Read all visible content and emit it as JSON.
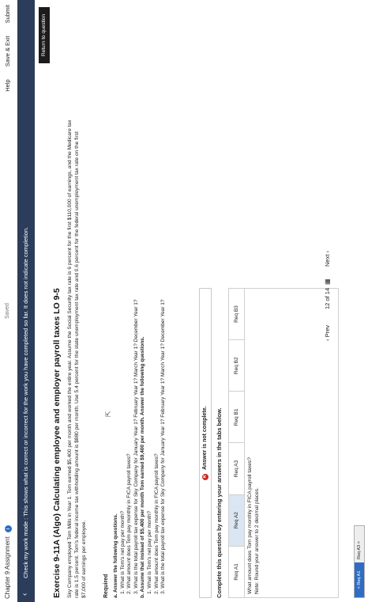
{
  "topbar": {
    "chapter": "Chapter 9 Assignment",
    "saved": "Saved",
    "help": "Help",
    "save_exit": "Save & Exit",
    "submit": "Submit"
  },
  "mode_bar": {
    "text": "Check my work mode : This shows what is correct or incorrect for the work you have completed so far. It does not indicate completion."
  },
  "return_button": "Return to question",
  "exercise": {
    "title": "Exercise 9-11A (Algo) Calculating employee and employer payroll taxes LO 9-5",
    "paragraph": "Sky Company employed Tom Mills in Year 1. Tom earned $5,400 per month and worked the entire year. Assume the Social Security tax rate is 6 percent for the first $110,000 of earnings, and the Medicare tax rate is 1.5 percent. Tom's federal income tax withholding amount is $880 per month. Use 5.4 percent for the state unemployment tax rate and 0.6 percent for the federal unemployment tax rate on the first $7,000 of earnings per employee.",
    "required_label": "Required",
    "a_label": "a. Answer the following questions.",
    "a1": "1. What is Tom's net pay per month?",
    "a2": "2. What amount does Tom pay monthly in FICA payroll taxes?",
    "a3": "3. What is the total payroll tax expense for Sky Company for January Year 1? February Year 1? March Year 1? December Year 1?",
    "b_label": "b. Assume that instead of $5,400 per month Tom earned $9,400 per month. Answer the following questions.",
    "b1": "1. What is Tom's net pay per month?",
    "b2": "2. What amount does Tom pay monthly in FICA payroll taxes?",
    "b3": "3. What is the total payroll tax expense for Sky Company for January Year 1? February Year 1? March Year 1? December Year 1?"
  },
  "status": {
    "error": "Answer is not complete."
  },
  "instructions": "Complete this question by entering your answers in the tabs below.",
  "tabs": [
    "Req A1",
    "Req A2",
    "Req A3",
    "Req B1",
    "Req B2",
    "Req B3"
  ],
  "active_tab": "Req A2",
  "tab_content": {
    "question": "What amount does Tom pay monthly in FICA payroll taxes?",
    "note": "Note: Round your answer to 2 decimal places."
  },
  "answer_nav": {
    "req_button": "< Req A1",
    "next_button": "Req A3 >"
  },
  "pager": {
    "prev": "Prev",
    "page_current": "12",
    "page_sep": "of",
    "page_total": "14",
    "next": "Next"
  },
  "colors": {
    "mode_bar_bg": "#2b3d5a",
    "active_tab_bg": "#dbe6f3",
    "error_icon": "#c8281e",
    "info_icon": "#2f6dc4"
  }
}
